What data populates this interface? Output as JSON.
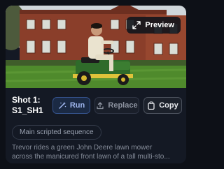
{
  "card": {
    "preview_label": "Preview",
    "title_line1": "Shot 1:",
    "title_line2": "S1_SH1",
    "buttons": {
      "run": "Run",
      "replace": "Replace",
      "copy": "Copy"
    },
    "tag": "Main scripted sequence",
    "description_line1": "Trevor rides a green John Deere lawn mower",
    "description_line2": "across the manicured front lawn of a tall multi-sto..."
  },
  "colors": {
    "card_bg": "#141924",
    "run_accent": "#9fb6ee",
    "lawn_green": "#4f8a2c",
    "brick": "#8a3e2a"
  }
}
